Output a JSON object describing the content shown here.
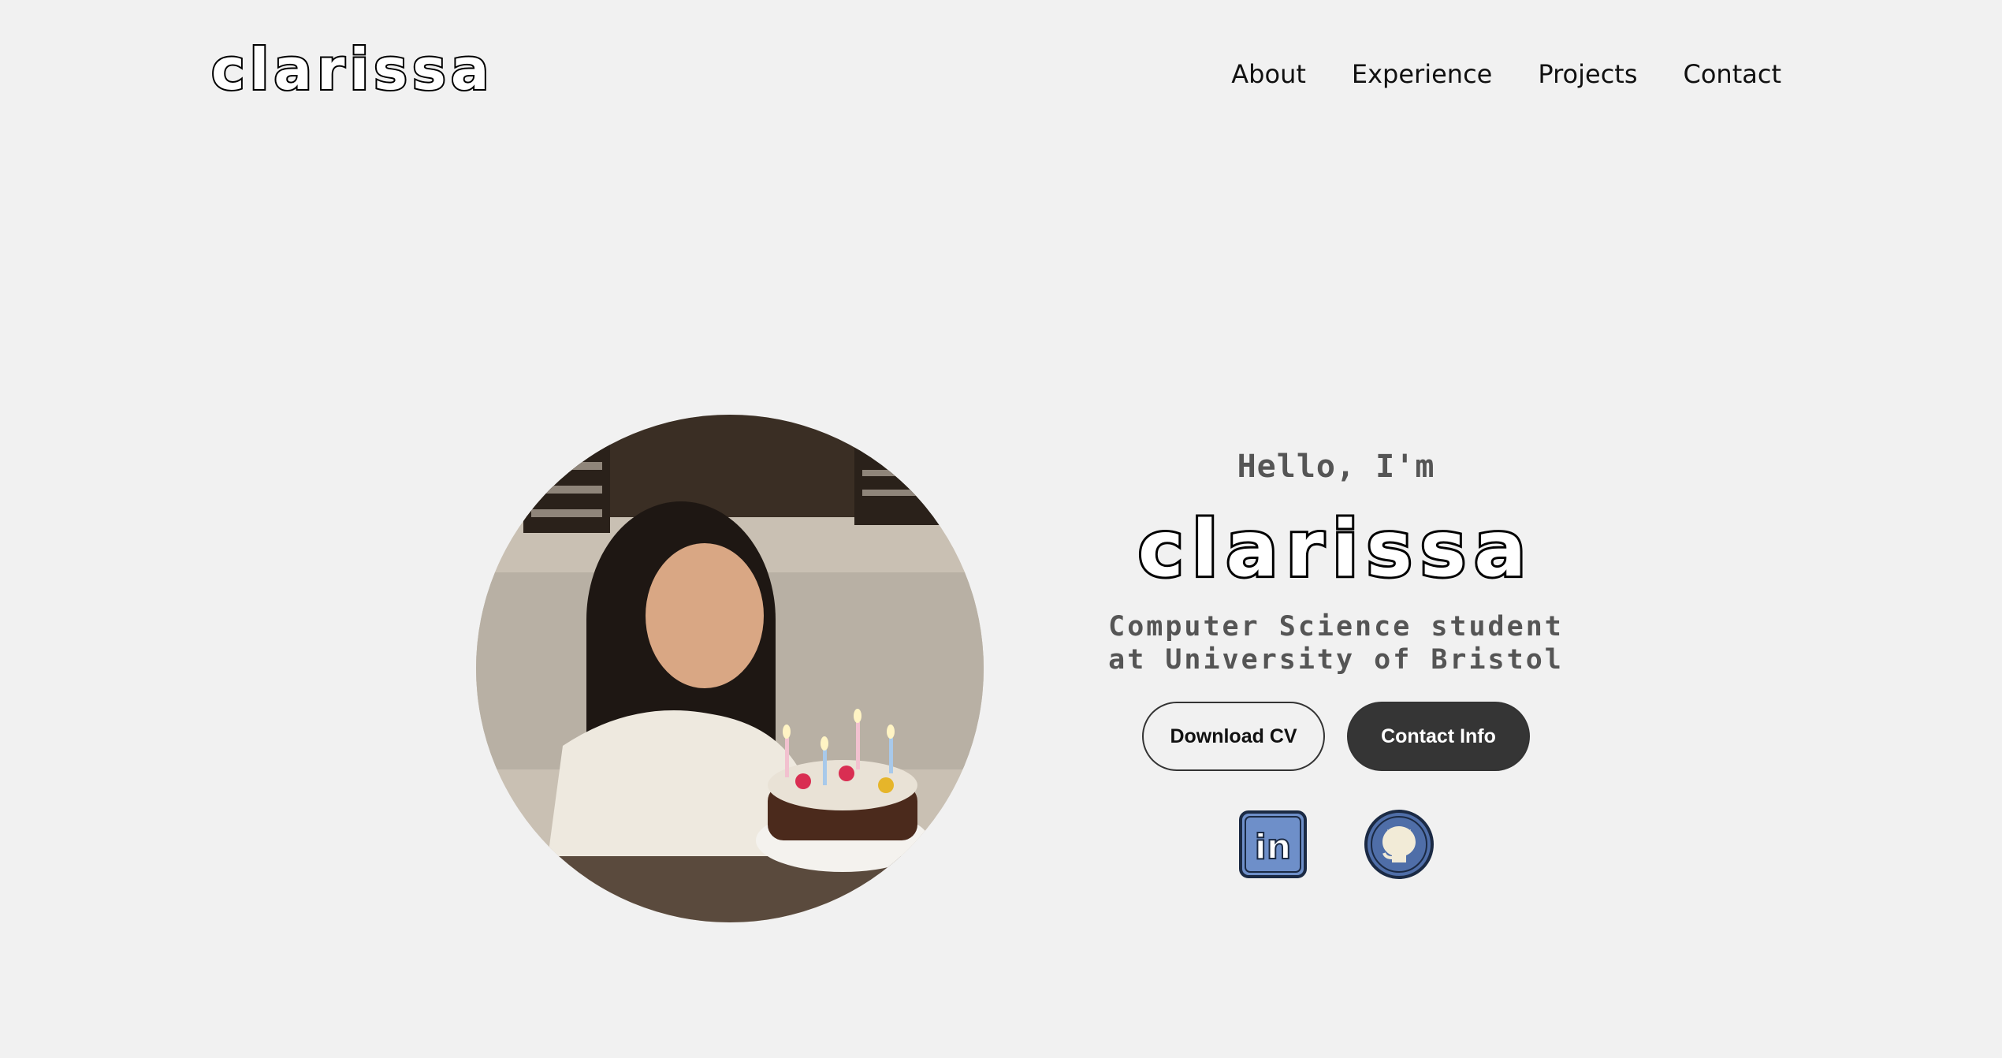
{
  "header": {
    "brand": "clarissa",
    "nav": [
      {
        "label": "About"
      },
      {
        "label": "Experience"
      },
      {
        "label": "Projects"
      },
      {
        "label": "Contact"
      }
    ]
  },
  "hero": {
    "greeting": "Hello, I'm",
    "name": "clarissa",
    "subtitle_line1": "Computer Science student",
    "subtitle_line2": "at University of Bristol",
    "buttons": {
      "download_cv": "Download CV",
      "contact_info": "Contact Info"
    },
    "socials": [
      {
        "icon": "linkedin-icon",
        "color": "#6e8fc9"
      },
      {
        "icon": "github-icon",
        "color": "#4f6ea8"
      }
    ]
  },
  "colors": {
    "background": "#f1f1f1",
    "button_dark": "#353535",
    "subtitle_gray": "#555555"
  }
}
